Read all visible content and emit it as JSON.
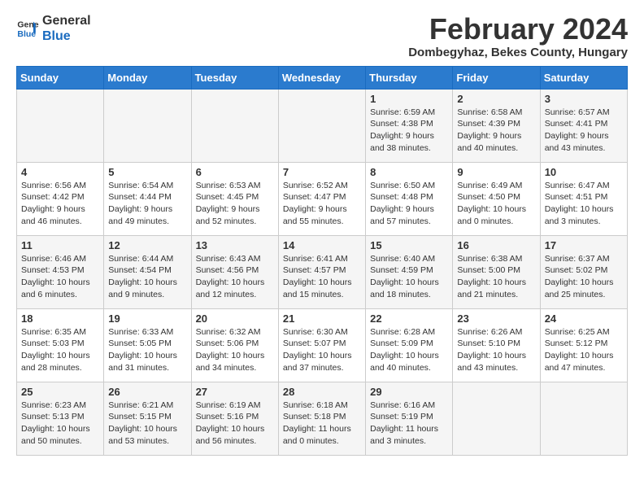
{
  "logo": {
    "line1": "General",
    "line2": "Blue"
  },
  "title": "February 2024",
  "subtitle": "Dombegyhaz, Bekes County, Hungary",
  "days_of_week": [
    "Sunday",
    "Monday",
    "Tuesday",
    "Wednesday",
    "Thursday",
    "Friday",
    "Saturday"
  ],
  "weeks": [
    [
      {
        "day": "",
        "info": ""
      },
      {
        "day": "",
        "info": ""
      },
      {
        "day": "",
        "info": ""
      },
      {
        "day": "",
        "info": ""
      },
      {
        "day": "1",
        "info": "Sunrise: 6:59 AM\nSunset: 4:38 PM\nDaylight: 9 hours\nand 38 minutes."
      },
      {
        "day": "2",
        "info": "Sunrise: 6:58 AM\nSunset: 4:39 PM\nDaylight: 9 hours\nand 40 minutes."
      },
      {
        "day": "3",
        "info": "Sunrise: 6:57 AM\nSunset: 4:41 PM\nDaylight: 9 hours\nand 43 minutes."
      }
    ],
    [
      {
        "day": "4",
        "info": "Sunrise: 6:56 AM\nSunset: 4:42 PM\nDaylight: 9 hours\nand 46 minutes."
      },
      {
        "day": "5",
        "info": "Sunrise: 6:54 AM\nSunset: 4:44 PM\nDaylight: 9 hours\nand 49 minutes."
      },
      {
        "day": "6",
        "info": "Sunrise: 6:53 AM\nSunset: 4:45 PM\nDaylight: 9 hours\nand 52 minutes."
      },
      {
        "day": "7",
        "info": "Sunrise: 6:52 AM\nSunset: 4:47 PM\nDaylight: 9 hours\nand 55 minutes."
      },
      {
        "day": "8",
        "info": "Sunrise: 6:50 AM\nSunset: 4:48 PM\nDaylight: 9 hours\nand 57 minutes."
      },
      {
        "day": "9",
        "info": "Sunrise: 6:49 AM\nSunset: 4:50 PM\nDaylight: 10 hours\nand 0 minutes."
      },
      {
        "day": "10",
        "info": "Sunrise: 6:47 AM\nSunset: 4:51 PM\nDaylight: 10 hours\nand 3 minutes."
      }
    ],
    [
      {
        "day": "11",
        "info": "Sunrise: 6:46 AM\nSunset: 4:53 PM\nDaylight: 10 hours\nand 6 minutes."
      },
      {
        "day": "12",
        "info": "Sunrise: 6:44 AM\nSunset: 4:54 PM\nDaylight: 10 hours\nand 9 minutes."
      },
      {
        "day": "13",
        "info": "Sunrise: 6:43 AM\nSunset: 4:56 PM\nDaylight: 10 hours\nand 12 minutes."
      },
      {
        "day": "14",
        "info": "Sunrise: 6:41 AM\nSunset: 4:57 PM\nDaylight: 10 hours\nand 15 minutes."
      },
      {
        "day": "15",
        "info": "Sunrise: 6:40 AM\nSunset: 4:59 PM\nDaylight: 10 hours\nand 18 minutes."
      },
      {
        "day": "16",
        "info": "Sunrise: 6:38 AM\nSunset: 5:00 PM\nDaylight: 10 hours\nand 21 minutes."
      },
      {
        "day": "17",
        "info": "Sunrise: 6:37 AM\nSunset: 5:02 PM\nDaylight: 10 hours\nand 25 minutes."
      }
    ],
    [
      {
        "day": "18",
        "info": "Sunrise: 6:35 AM\nSunset: 5:03 PM\nDaylight: 10 hours\nand 28 minutes."
      },
      {
        "day": "19",
        "info": "Sunrise: 6:33 AM\nSunset: 5:05 PM\nDaylight: 10 hours\nand 31 minutes."
      },
      {
        "day": "20",
        "info": "Sunrise: 6:32 AM\nSunset: 5:06 PM\nDaylight: 10 hours\nand 34 minutes."
      },
      {
        "day": "21",
        "info": "Sunrise: 6:30 AM\nSunset: 5:07 PM\nDaylight: 10 hours\nand 37 minutes."
      },
      {
        "day": "22",
        "info": "Sunrise: 6:28 AM\nSunset: 5:09 PM\nDaylight: 10 hours\nand 40 minutes."
      },
      {
        "day": "23",
        "info": "Sunrise: 6:26 AM\nSunset: 5:10 PM\nDaylight: 10 hours\nand 43 minutes."
      },
      {
        "day": "24",
        "info": "Sunrise: 6:25 AM\nSunset: 5:12 PM\nDaylight: 10 hours\nand 47 minutes."
      }
    ],
    [
      {
        "day": "25",
        "info": "Sunrise: 6:23 AM\nSunset: 5:13 PM\nDaylight: 10 hours\nand 50 minutes."
      },
      {
        "day": "26",
        "info": "Sunrise: 6:21 AM\nSunset: 5:15 PM\nDaylight: 10 hours\nand 53 minutes."
      },
      {
        "day": "27",
        "info": "Sunrise: 6:19 AM\nSunset: 5:16 PM\nDaylight: 10 hours\nand 56 minutes."
      },
      {
        "day": "28",
        "info": "Sunrise: 6:18 AM\nSunset: 5:18 PM\nDaylight: 11 hours\nand 0 minutes."
      },
      {
        "day": "29",
        "info": "Sunrise: 6:16 AM\nSunset: 5:19 PM\nDaylight: 11 hours\nand 3 minutes."
      },
      {
        "day": "",
        "info": ""
      },
      {
        "day": "",
        "info": ""
      }
    ]
  ]
}
